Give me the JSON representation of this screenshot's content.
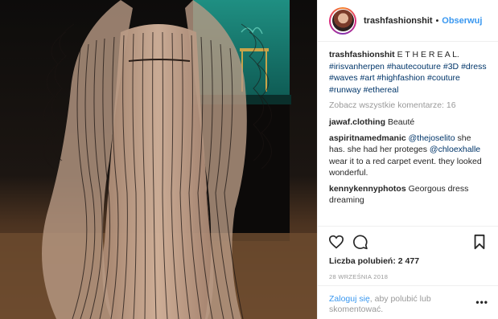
{
  "post": {
    "username": "trashfashionshit",
    "follow_label": "Obserwuj",
    "separator": "•",
    "caption": {
      "user": "trashfashionshit",
      "text": "E T H E R E A L.",
      "hashtags": [
        "#irisvanherpen",
        "#hautecouture",
        "#3D",
        "#dress",
        "#waves",
        "#art",
        "#highfashion",
        "#couture",
        "#runway",
        "#ethereal"
      ]
    },
    "view_all_comments": "Zobacz wszystkie komentarze: 16",
    "comments": [
      {
        "user": "jawaf.clothing",
        "text": "Beauté"
      },
      {
        "user": "aspiritnamedmanic",
        "mention": "@thejoselito",
        "text_before": "",
        "text_middle": " she has. she had her proteges ",
        "mention2": "@chloexhalle",
        "text_after": " wear it to a red carpet event. they looked wonderful."
      },
      {
        "user": "kennykennyphotos",
        "text": "Georgous dress dreaming"
      }
    ],
    "likes_label": "Liczba polubień:",
    "likes_count": "2 477",
    "date": "28 WRZEŚNIA 2018",
    "login_link": "Zaloguj się",
    "login_text": ", aby polubić lub skomentować.",
    "more_label": "•••"
  },
  "icons": {
    "like": "heart-icon",
    "comment": "comment-icon",
    "share": "share-icon",
    "save": "bookmark-icon"
  },
  "colors": {
    "link_blue": "#3897f0",
    "hashtag": "#003569",
    "muted": "#999999",
    "text": "#262626"
  }
}
